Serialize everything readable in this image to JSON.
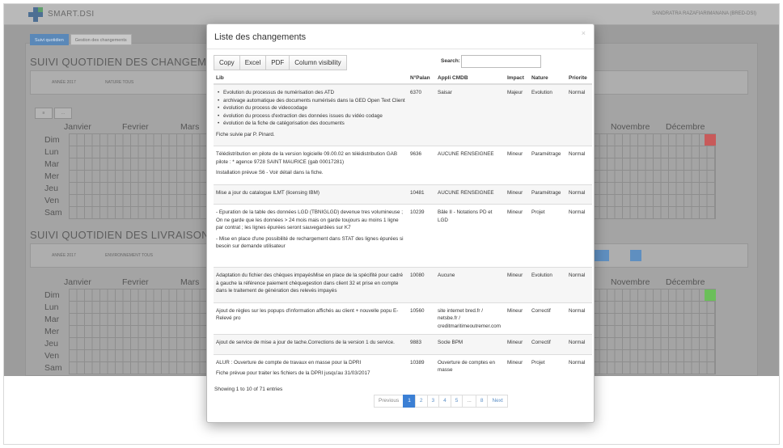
{
  "app": {
    "brand": "SMART.DSI",
    "user": "SANDRATRA RAZAFIARIMANANA (BRED-DSI)",
    "tabs": [
      "Suivi quotidien",
      "Gestion des changements"
    ]
  },
  "background": {
    "section1_title": "SUIVI QUOTIDIEN DES CHANGEMENTS",
    "section2_title": "SUIVI QUOTIDIEN DES LIVRAISONS",
    "filters1": [
      "ANNÉE 2017",
      "NATURE TOUS"
    ],
    "filters2": [
      "ANNÉE 2017",
      "ENVIRONNEMENT TOUS"
    ],
    "months_left": [
      "Janvier",
      "Fevrier",
      "Mars"
    ],
    "months_right": [
      "Novembre",
      "Décembre"
    ],
    "days": [
      "Dim",
      "Lun",
      "Mar",
      "Mer",
      "Jeu",
      "Ven",
      "Sam"
    ],
    "accent_red": "#c85a5a",
    "accent_green": "#6bbf5a"
  },
  "modal": {
    "title": "Liste des changements",
    "close_label": "×",
    "buttons": [
      "Copy",
      "Excel",
      "PDF",
      "Column visibility"
    ],
    "search_label": "Search:",
    "search_value": "",
    "columns": [
      "Lib",
      "N°Palan",
      "Appli CMDB",
      "Impact",
      "Nature",
      "Priorite"
    ],
    "rows": [
      {
        "lib_list": [
          "Evolution du processus de numérisation des ATD",
          "archivage automatique des documents numérisés dans la GED Open Text Client",
          "évolution du process de videocodage",
          "évolution du process d'extraction des données issues du vidéo codage",
          "évolution de la fiche de catégorisation des documents"
        ],
        "lib_notes": [
          "Fiche suivie par P. Pinard."
        ],
        "palan": "6370",
        "appli": "Saisar",
        "impact": "Majeur",
        "nature": "Evolution",
        "priorite": "Normal"
      },
      {
        "lib_list": [],
        "lib_notes": [
          "Télédistribution en pilote de la version logicielle 09.00.02 en télédistribution GAB pilote : * agence 9728 SAINT MAURICE (gab 00017281)",
          "Installation prévue S6 - Voir détail dans la fiche."
        ],
        "palan": "9636",
        "appli": "AUCUNE RENSEIGNEE",
        "impact": "Mineur",
        "nature": "Paramétrage",
        "priorite": "Normal"
      },
      {
        "lib_list": [],
        "lib_notes": [
          "Mise a jour du catalogue ILMT (licensing IBM)"
        ],
        "palan": "10481",
        "appli": "AUCUNE RENSEIGNEE",
        "impact": "Mineur",
        "nature": "Paramétrage",
        "priorite": "Normal"
      },
      {
        "lib_list": [],
        "lib_notes": [
          "- Epuration de la table des données LGD (TBNIGLGD) devenue tres volumineuse ; On ne garde que les données > 24 mois mais on garde toujours au moins 1 ligne par contrat ; les lignes épurées seront sauvegardées sur K7",
          "- Mise en place d'une possibilité de rechargement dans STAT des lignes épurées si besoin sur demande utilisateur"
        ],
        "palan": "10239",
        "appli": "Bâle II - Notations PD et LGD",
        "impact": "Mineur",
        "nature": "Projet",
        "priorite": "Normal"
      },
      {
        "lib_list": [],
        "lib_notes": [
          "Adaptation du fichier des chèques impayésMise en place de la spécifité pour cadré à gauche la référence paiement chèquegestion dans client 32 et prise en compte dans le traitement de génération des relevés impayés"
        ],
        "palan": "10080",
        "appli": "Aucune",
        "impact": "Mineur",
        "nature": "Evolution",
        "priorite": "Normal"
      },
      {
        "lib_list": [],
        "lib_notes": [
          "Ajout de règles sur les popups d'information affichés au client + nouvelle popu E-Relevé pro"
        ],
        "palan": "10560",
        "appli": "site internet bred.fr / netsbe.fr / creditmaritimeoutremer.com",
        "impact": "Mineur",
        "nature": "Correctif",
        "priorite": "Normal"
      },
      {
        "lib_list": [],
        "lib_notes": [
          "Ajout de service de mise a jour de tache.Corrections de la version 1 du service."
        ],
        "palan": "9883",
        "appli": "Socle BPM",
        "impact": "Mineur",
        "nature": "Correctif",
        "priorite": "Normal"
      },
      {
        "lib_list": [],
        "lib_notes": [
          "ALUR : Ouverture de compte de travaux en masse pour la DPRI",
          "Fiche prévue pour traiter les fichiers de la DPRI jusqu'au 31/03/2017"
        ],
        "palan": "10389",
        "appli": "Ouverture de comptes en masse",
        "impact": "Mineur",
        "nature": "Projet",
        "priorite": "Normal"
      }
    ],
    "info": "Showing 1 to 10 of 71 entries",
    "pagination": [
      "Previous",
      "1",
      "2",
      "3",
      "4",
      "5",
      "...",
      "8",
      "Next"
    ],
    "current_page": "1"
  }
}
